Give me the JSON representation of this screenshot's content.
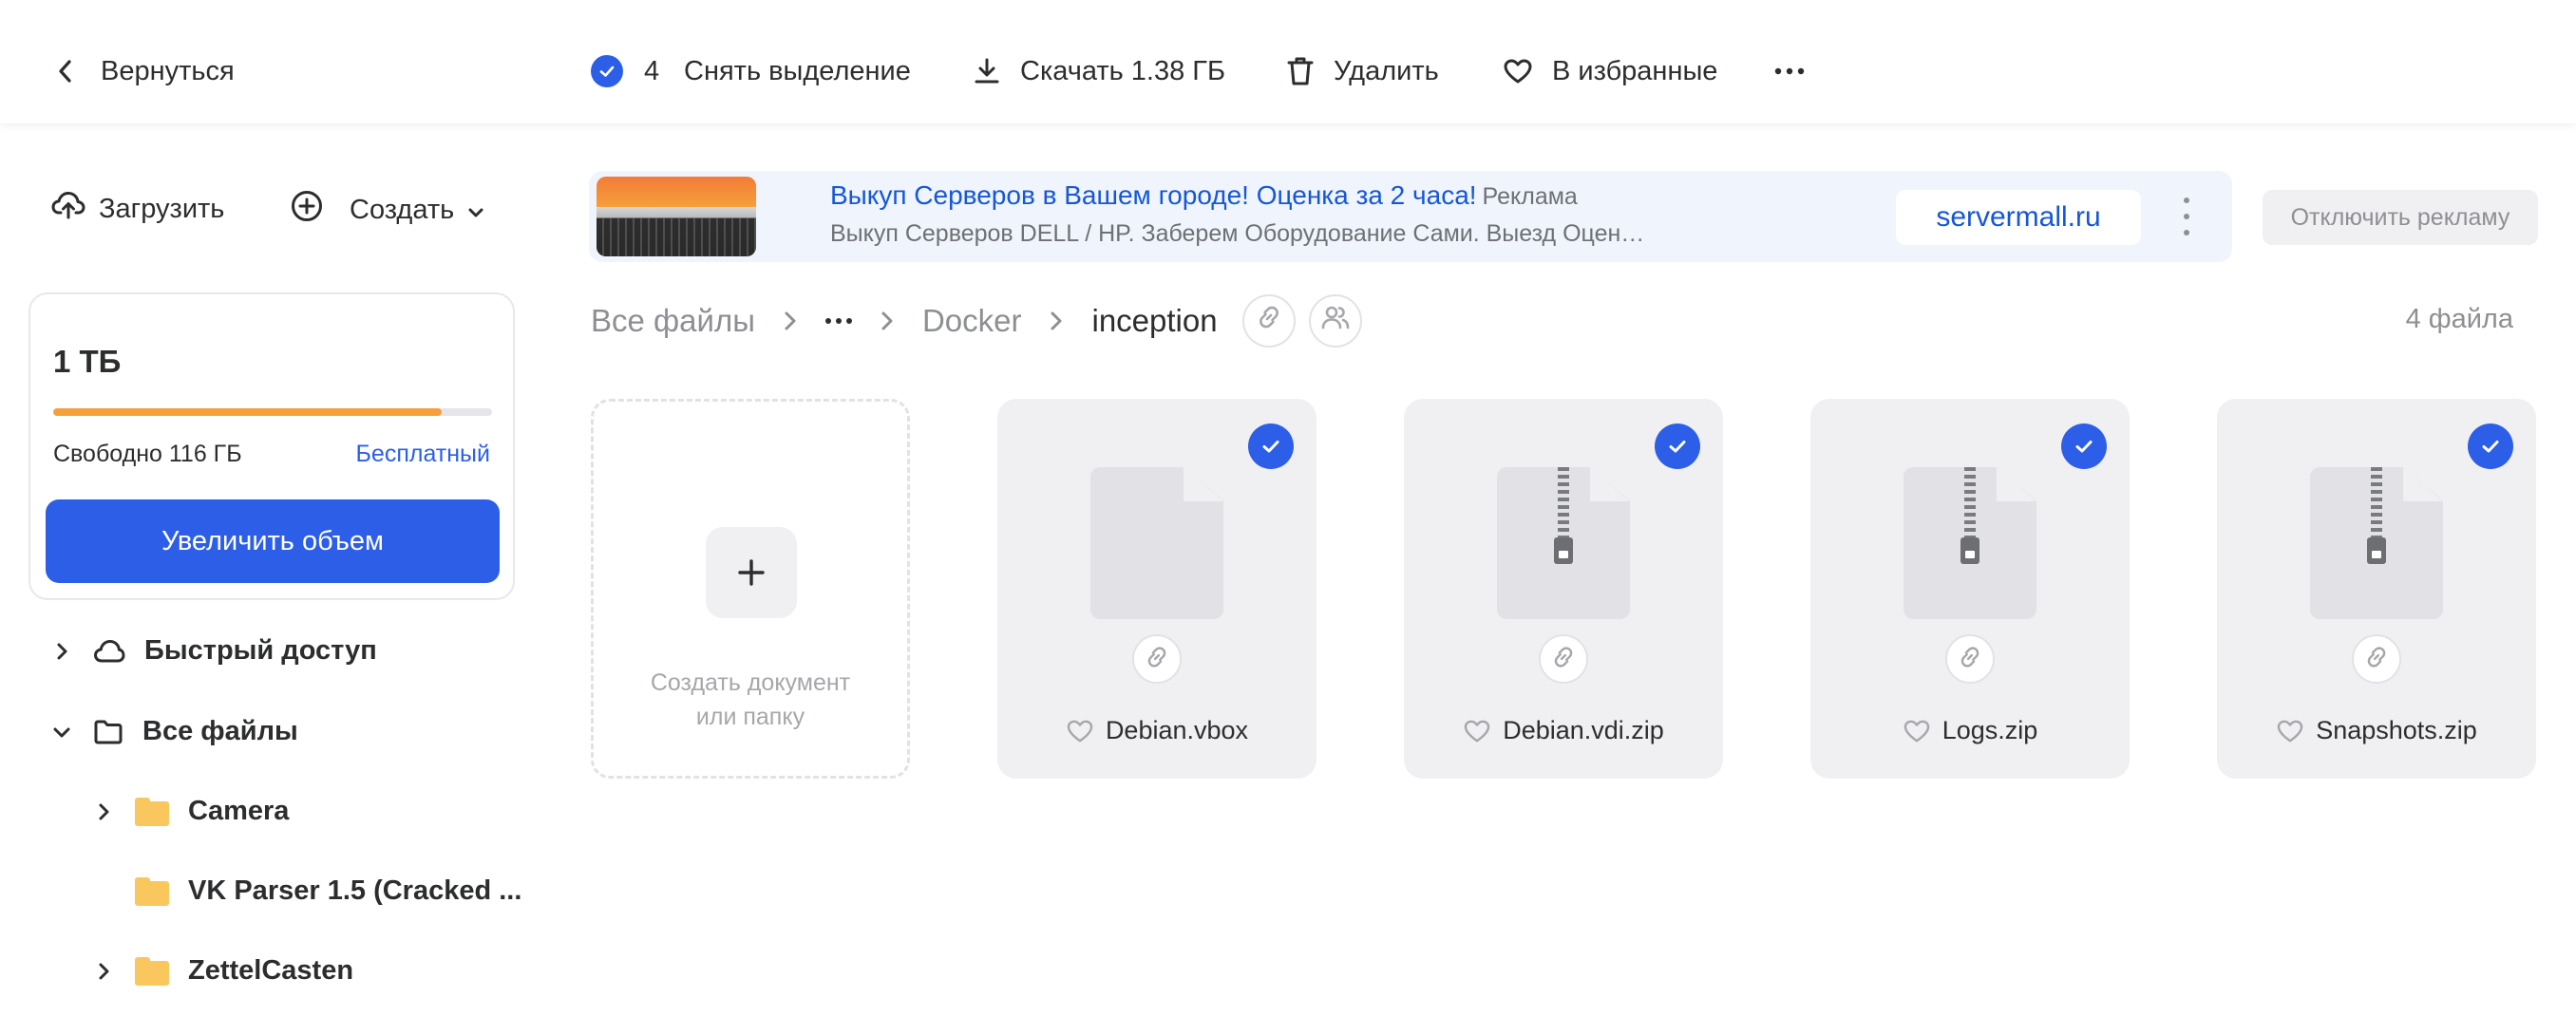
{
  "toolbar": {
    "back_label": "Вернуться",
    "selected_count": "4",
    "deselect_label": "Снять выделение",
    "download_label": "Скачать 1.38 ГБ",
    "delete_label": "Удалить",
    "favorites_label": "В избранные",
    "more_icon": "more-horizontal-icon"
  },
  "sidebar": {
    "upload_label": "Загрузить",
    "create_label": "Создать",
    "storage": {
      "total": "1 ТБ",
      "used_fraction": 0.885,
      "free_text": "Свободно 116 ГБ",
      "plan": "Бесплатный",
      "increase_label": "Увеличить объем"
    },
    "nav": {
      "quick_access": "Быстрый доступ",
      "all_files": "Все файлы",
      "folders": [
        "Camera",
        "VK Parser 1.5 (Cracked ...",
        "ZettelCasten"
      ]
    }
  },
  "ad": {
    "title": "Выкуп Серверов в Вашем городе! Оценка за 2 часа!",
    "tag": "Реклама",
    "text": "Выкуп Серверов DELL / HP. Заберем Оборудование Сами. Выезд Оцен…",
    "site": "servermall.ru",
    "disable_label": "Отключить рекламу"
  },
  "breadcrumb": {
    "root": "Все файлы",
    "parent": "Docker",
    "current": "inception",
    "file_count": "4 файла"
  },
  "create_tile": {
    "label_line1": "Создать документ",
    "label_line2": "или папку"
  },
  "files": [
    {
      "name": "Debian.vbox",
      "type": "document",
      "selected": true
    },
    {
      "name": "Debian.vdi.zip",
      "type": "archive",
      "selected": true
    },
    {
      "name": "Logs.zip",
      "type": "archive",
      "selected": true
    },
    {
      "name": "Snapshots.zip",
      "type": "archive",
      "selected": true
    }
  ],
  "colors": {
    "accent": "#2c5ee8",
    "storage_bar": "#f5a03a",
    "folder": "#f9c75e",
    "ad_link": "#1557d8"
  }
}
